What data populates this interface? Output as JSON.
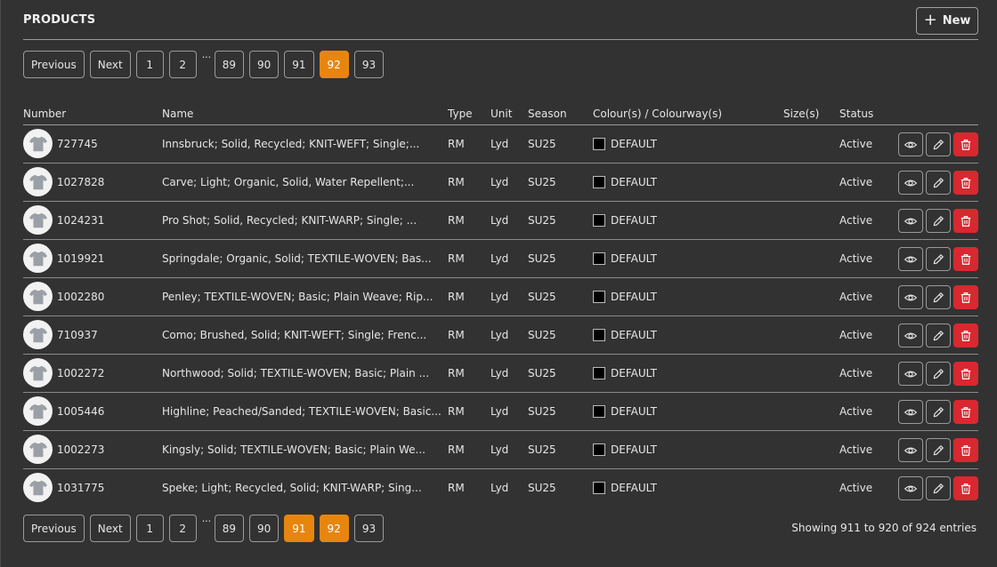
{
  "header": {
    "title": "PRODUCTS",
    "new_label": "New"
  },
  "pagination_top": {
    "prev_label": "Previous",
    "next_label": "Next",
    "pages": [
      "1",
      "2",
      "89",
      "90",
      "91",
      "92",
      "93"
    ],
    "ellipsis": "...",
    "active_pages": [
      "92"
    ]
  },
  "pagination_bottom": {
    "prev_label": "Previous",
    "next_label": "Next",
    "pages": [
      "1",
      "2",
      "89",
      "90",
      "91",
      "92",
      "93"
    ],
    "ellipsis": "...",
    "active_pages": [
      "91",
      "92"
    ]
  },
  "table": {
    "columns": [
      "Number",
      "Name",
      "Type",
      "Unit",
      "Season",
      "Colour(s) / Colourway(s)",
      "Size(s)",
      "Status"
    ],
    "rows": [
      {
        "number": "727745",
        "name": "Innsbruck; Solid, Recycled; KNIT-WEFT; Single;...",
        "type": "RM",
        "unit": "Lyd",
        "season": "SU25",
        "colour": "DEFAULT",
        "sizes": "",
        "status": "Active"
      },
      {
        "number": "1027828",
        "name": "Carve; Light; Organic, Solid, Water Repellent;...",
        "type": "RM",
        "unit": "Lyd",
        "season": "SU25",
        "colour": "DEFAULT",
        "sizes": "",
        "status": "Active"
      },
      {
        "number": "1024231",
        "name": "Pro Shot; Solid, Recycled; KNIT-WARP; Single; ...",
        "type": "RM",
        "unit": "Lyd",
        "season": "SU25",
        "colour": "DEFAULT",
        "sizes": "",
        "status": "Active"
      },
      {
        "number": "1019921",
        "name": "Springdale; Organic, Solid; TEXTILE-WOVEN; Bas...",
        "type": "RM",
        "unit": "Lyd",
        "season": "SU25",
        "colour": "DEFAULT",
        "sizes": "",
        "status": "Active"
      },
      {
        "number": "1002280",
        "name": "Penley; TEXTILE-WOVEN; Basic; Plain Weave; Rip...",
        "type": "RM",
        "unit": "Lyd",
        "season": "SU25",
        "colour": "DEFAULT",
        "sizes": "",
        "status": "Active"
      },
      {
        "number": "710937",
        "name": "Como; Brushed, Solid; KNIT-WEFT; Single; Frenc...",
        "type": "RM",
        "unit": "Lyd",
        "season": "SU25",
        "colour": "DEFAULT",
        "sizes": "",
        "status": "Active"
      },
      {
        "number": "1002272",
        "name": "Northwood; Solid; TEXTILE-WOVEN; Basic; Plain ...",
        "type": "RM",
        "unit": "Lyd",
        "season": "SU25",
        "colour": "DEFAULT",
        "sizes": "",
        "status": "Active"
      },
      {
        "number": "1005446",
        "name": "Highline; Peached/Sanded; TEXTILE-WOVEN; Basic...",
        "type": "RM",
        "unit": "Lyd",
        "season": "SU25",
        "colour": "DEFAULT",
        "sizes": "",
        "status": "Active"
      },
      {
        "number": "1002273",
        "name": "Kingsly; Solid; TEXTILE-WOVEN; Basic; Plain We...",
        "type": "RM",
        "unit": "Lyd",
        "season": "SU25",
        "colour": "DEFAULT",
        "sizes": "",
        "status": "Active"
      },
      {
        "number": "1031775",
        "name": "Speke; Light; Recycled, Solid; KNIT-WARP; Sing...",
        "type": "RM",
        "unit": "Lyd",
        "season": "SU25",
        "colour": "DEFAULT",
        "sizes": "",
        "status": "Active"
      }
    ],
    "row_icons": {
      "thumbnail": "tshirt-icon",
      "view": "eye-icon",
      "edit": "pencil-icon",
      "delete": "trash-icon"
    }
  },
  "footer": {
    "showing_text": "Showing 911 to 920 of 924 entries"
  },
  "colors": {
    "background": "#323232",
    "accent": "#e7860f",
    "danger": "#d9282f",
    "text": "#e6e6e6"
  }
}
